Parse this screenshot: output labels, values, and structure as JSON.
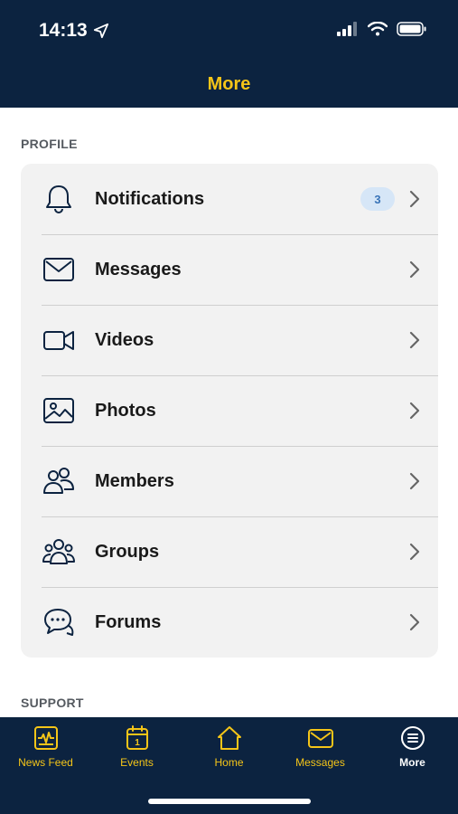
{
  "status_bar": {
    "time": "14:13"
  },
  "nav": {
    "title": "More"
  },
  "sections": {
    "profile": "PROFILE",
    "support": "SUPPORT"
  },
  "profile_items": [
    {
      "label": "Notifications",
      "icon": "bell-icon",
      "badge": "3"
    },
    {
      "label": "Messages",
      "icon": "envelope-icon"
    },
    {
      "label": "Videos",
      "icon": "video-camera-icon"
    },
    {
      "label": "Photos",
      "icon": "photo-icon"
    },
    {
      "label": "Members",
      "icon": "members-icon"
    },
    {
      "label": "Groups",
      "icon": "groups-icon"
    },
    {
      "label": "Forums",
      "icon": "chat-bubbles-icon"
    }
  ],
  "tab_bar": {
    "items": [
      {
        "label": "News Feed",
        "icon": "news-feed-icon"
      },
      {
        "label": "Events",
        "icon": "calendar-icon",
        "calendar_day": "1"
      },
      {
        "label": "Home",
        "icon": "home-icon"
      },
      {
        "label": "Messages",
        "icon": "envelope-icon"
      },
      {
        "label": "More",
        "icon": "more-list-icon",
        "active": true
      }
    ]
  },
  "colors": {
    "navy": "#0c2340",
    "gold": "#f5c518",
    "card_bg": "#f2f2f2",
    "badge_bg": "#d6e6f7",
    "badge_text": "#3a74b8"
  }
}
